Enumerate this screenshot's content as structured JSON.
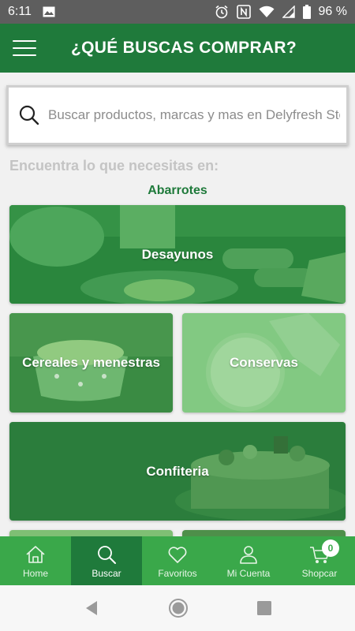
{
  "status_bar": {
    "time": "6:11",
    "battery": "96 %"
  },
  "header": {
    "title": "¿QUÉ BUSCAS COMPRAR?"
  },
  "search": {
    "placeholder": "Buscar productos, marcas y mas en Delyfresh Store"
  },
  "prompt": "Encuentra lo que necesitas en:",
  "section": {
    "title": "Abarrotes"
  },
  "categories": [
    {
      "label": "Desayunos"
    },
    {
      "label": "Cereales y menestras"
    },
    {
      "label": "Conservas"
    },
    {
      "label": "Confiteria"
    }
  ],
  "bottom_nav": {
    "items": [
      {
        "label": "Home",
        "icon": "home-icon"
      },
      {
        "label": "Buscar",
        "icon": "search-icon"
      },
      {
        "label": "Favoritos",
        "icon": "heart-icon"
      },
      {
        "label": "Mi Cuenta",
        "icon": "user-icon"
      },
      {
        "label": "Shopcar",
        "icon": "cart-icon"
      }
    ],
    "active": "Buscar",
    "cart_count": "0"
  },
  "colors": {
    "primary": "#1f7a3b",
    "nav": "#3aa84a",
    "accent": "#1f7a3b"
  }
}
